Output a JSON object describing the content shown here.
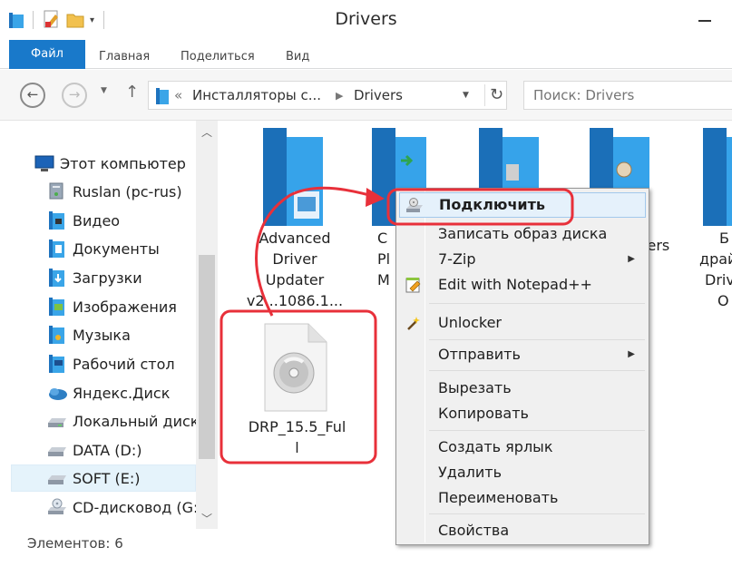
{
  "window": {
    "title": "Drivers"
  },
  "ribbon": {
    "file_tab": "Файл",
    "home_tab": "Главная",
    "share_tab": "Поделиться",
    "view_tab": "Вид"
  },
  "address": {
    "crumb_prefix": "«",
    "crumb_parent": "Инсталляторы с...",
    "crumb_current": "Drivers",
    "search_placeholder": "Поиск: Drivers"
  },
  "navpane": {
    "items": [
      {
        "label": "Этот компьютер",
        "icon": "computer-icon"
      },
      {
        "label": "Ruslan (pc-rus)",
        "icon": "network-drive-icon"
      },
      {
        "label": "Видео",
        "icon": "video-folder-icon"
      },
      {
        "label": "Документы",
        "icon": "documents-folder-icon"
      },
      {
        "label": "Загрузки",
        "icon": "downloads-folder-icon"
      },
      {
        "label": "Изображения",
        "icon": "pictures-folder-icon"
      },
      {
        "label": "Музыка",
        "icon": "music-folder-icon"
      },
      {
        "label": "Рабочий стол",
        "icon": "desktop-folder-icon"
      },
      {
        "label": "Яндекс.Диск",
        "icon": "yandex-disk-icon"
      },
      {
        "label": "Локальный диск",
        "icon": "local-disk-icon"
      },
      {
        "label": "DATA (D:)",
        "icon": "drive-icon"
      },
      {
        "label": "SOFT (E:)",
        "icon": "drive-icon"
      },
      {
        "label": "CD-дисковод (G:)",
        "icon": "cd-drive-icon"
      }
    ]
  },
  "files": [
    {
      "label_lines": [
        "Advanced",
        "Driver",
        "Updater",
        "v2...1086.1..."
      ],
      "icon": "folder-icon"
    },
    {
      "label_lines": [
        "C",
        "Pl",
        "M"
      ],
      "icon": "folder-icon"
    },
    {
      "label_lines": [
        ""
      ],
      "icon": "folder-icon"
    },
    {
      "label_lines": [
        "vers"
      ],
      "icon": "folder-icon"
    },
    {
      "label_lines": [
        "Б",
        "драй",
        "Drive",
        "O"
      ],
      "icon": "folder-icon"
    },
    {
      "label_lines": [
        "DRP_15.5_Ful",
        "l"
      ],
      "icon": "disc-image-icon"
    }
  ],
  "context_menu": {
    "items": [
      {
        "label": "Подключить",
        "bold": true,
        "icon": "mount-icon",
        "highlight": true
      },
      {
        "label": "Записать образ диска"
      },
      {
        "label": "7-Zip",
        "submenu": true
      },
      {
        "label": "Edit with Notepad++",
        "icon": "notepad-icon"
      },
      {
        "label": "Unlocker",
        "icon": "wand-icon"
      },
      {
        "label": "Отправить",
        "submenu": true
      },
      {
        "label": "Вырезать"
      },
      {
        "label": "Копировать"
      },
      {
        "label": "Создать ярлык"
      },
      {
        "label": "Удалить"
      },
      {
        "label": "Переименовать"
      },
      {
        "label": "Свойства"
      }
    ]
  },
  "status": {
    "items_count": "Элементов: 6"
  },
  "colors": {
    "accent": "#1979ca",
    "annotation": "#e8303a",
    "folder": "#2b9ee6"
  }
}
